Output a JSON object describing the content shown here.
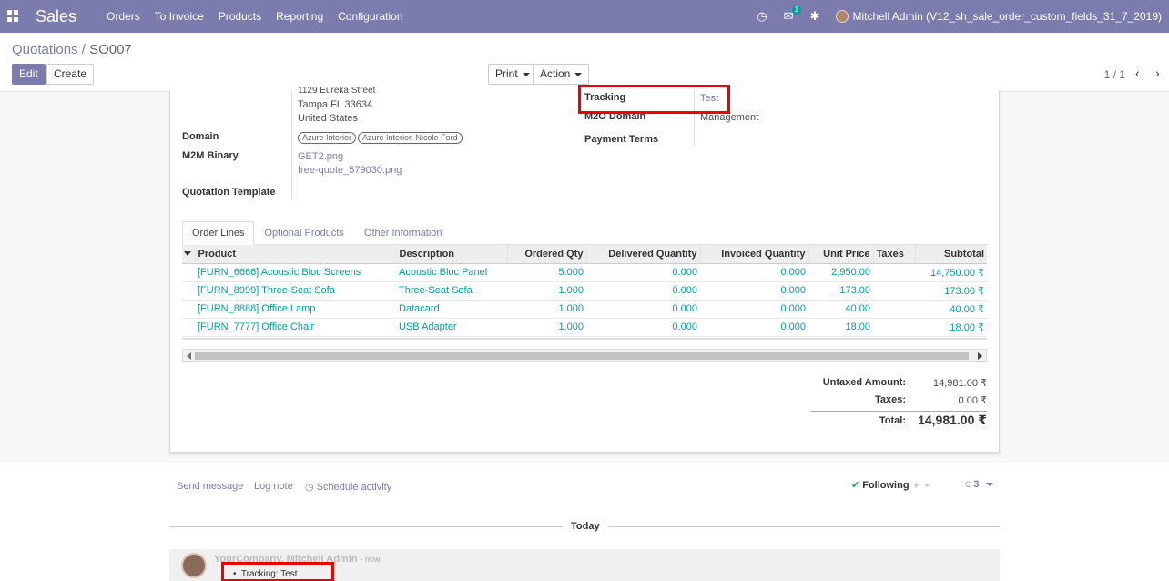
{
  "app": {
    "title": "Sales",
    "menu": [
      "Orders",
      "To Invoice",
      "Products",
      "Reporting",
      "Configuration"
    ],
    "notification_count": "1",
    "user": "Mitchell Admin (V12_sh_sale_order_custom_fields_31_7_2019)"
  },
  "control": {
    "breadcrumb_parent": "Quotations",
    "breadcrumb_sep": "/",
    "breadcrumb_current": "SO007",
    "edit_label": "Edit",
    "create_label": "Create",
    "print_label": "Print",
    "action_label": "Action",
    "pager": "1 / 1"
  },
  "form": {
    "address_line0": "1129 Eureka Street",
    "address_line1": "Tampa FL 33634",
    "address_line2": "United States",
    "domain_label": "Domain",
    "domain_tags": [
      "Azure Interior",
      "Azure Interior, Nicole Ford"
    ],
    "m2m_binary_label": "M2M Binary",
    "m2m_files": [
      "GET2.png",
      "free-quote_579030.png"
    ],
    "quotation_template_label": "Quotation Template",
    "tracking_label": "Tracking",
    "tracking_value": "Test",
    "m2o_domain_label": "M2O Domain",
    "m2o_domain_value": "Management",
    "payment_terms_label": "Payment Terms"
  },
  "tabs": [
    "Order Lines",
    "Optional Products",
    "Other Information"
  ],
  "order_lines": {
    "columns": [
      "Product",
      "Description",
      "Ordered Qty",
      "Delivered Quantity",
      "Invoiced Quantity",
      "Unit Price",
      "Taxes",
      "Subtotal"
    ],
    "rows": [
      [
        "[FURN_6666] Acoustic Bloc Screens",
        "Acoustic Bloc Panel",
        "5.000",
        "0.000",
        "0.000",
        "2,950.00",
        "",
        "14,750.00 ₹"
      ],
      [
        "[FURN_8999] Three-Seat Sofa",
        "Three-Seat Sofa",
        "1.000",
        "0.000",
        "0.000",
        "173.00",
        "",
        "173.00 ₹"
      ],
      [
        "[FURN_8888] Office Lamp",
        "Datacard",
        "1.000",
        "0.000",
        "0.000",
        "40.00",
        "",
        "40.00 ₹"
      ],
      [
        "[FURN_7777] Office Chair",
        "USB Adapter",
        "1.000",
        "0.000",
        "0.000",
        "18.00",
        "",
        "18.00 ₹"
      ]
    ]
  },
  "totals": {
    "untaxed_label": "Untaxed Amount:",
    "untaxed_value": "14,981.00 ₹",
    "taxes_label": "Taxes:",
    "taxes_value": "0.00 ₹",
    "total_label": "Total:",
    "total_value": "14,981.00 ₹"
  },
  "chatter": {
    "send_message": "Send message",
    "log_note": "Log note",
    "schedule_activity": "Schedule activity",
    "following": "Following",
    "followers_count": "3",
    "day": "Today",
    "author": "YourCompany, Mitchell Admin",
    "time": "- now",
    "tracking_line": "Tracking: Test"
  },
  "colors": {
    "brand": "#7c7bad",
    "link_teal": "#00a09d",
    "highlight": "#ee0000"
  }
}
